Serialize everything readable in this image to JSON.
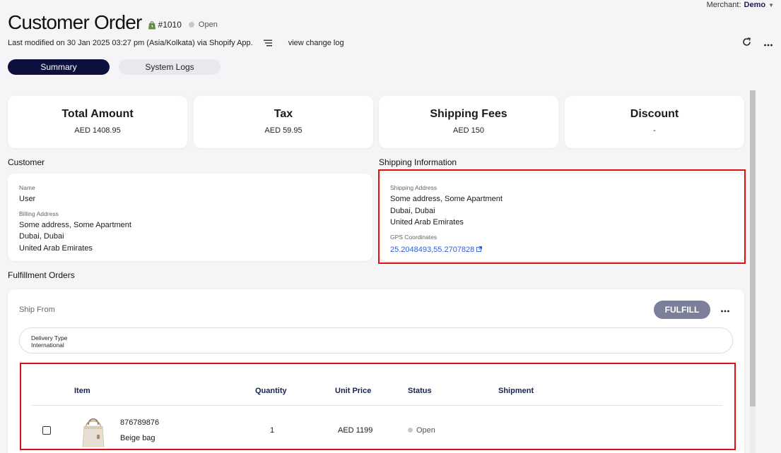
{
  "merchant": {
    "label": "Merchant:",
    "name": "Demo"
  },
  "header": {
    "title": "Customer Order",
    "order_number": "#1010",
    "status": "Open",
    "last_modified": "Last modified on 30 Jan 2025 03:27 pm (Asia/Kolkata) via Shopify App.",
    "change_log_link": "view change log"
  },
  "tabs": [
    {
      "label": "Summary",
      "active": true
    },
    {
      "label": "System Logs",
      "active": false
    }
  ],
  "stats": [
    {
      "label": "Total Amount",
      "value": "AED 1408.95"
    },
    {
      "label": "Tax",
      "value": "AED 59.95"
    },
    {
      "label": "Shipping Fees",
      "value": "AED 150"
    },
    {
      "label": "Discount",
      "value": "-"
    }
  ],
  "customer": {
    "heading": "Customer",
    "name_label": "Name",
    "name": "User",
    "billing_label": "Billing Address",
    "billing_lines": [
      "Some address, Some Apartment",
      "Dubai, Dubai",
      "United Arab Emirates"
    ]
  },
  "shipping": {
    "heading": "Shipping Information",
    "address_label": "Shipping Address",
    "address_lines": [
      "Some address, Some Apartment",
      "Dubai, Dubai",
      "United Arab Emirates"
    ],
    "gps_label": "GPS Coordinates",
    "gps_value": "25.2048493,55.2707828"
  },
  "fulfillment": {
    "heading": "Fulfillment Orders",
    "ship_from_label": "Ship From",
    "fulfill_button": "FULFILL",
    "delivery_type_label": "Delivery Type",
    "delivery_type_value": "International",
    "columns": [
      "Item",
      "Quantity",
      "Unit Price",
      "Status",
      "Shipment"
    ],
    "rows": [
      {
        "sku": "876789876",
        "name": "Beige bag",
        "quantity": "1",
        "unit_price": "AED 1199",
        "status": "Open",
        "shipment": ""
      }
    ]
  },
  "icons": {
    "shopify": "shopify-bag-icon",
    "list": "list-icon",
    "refresh": "refresh-icon",
    "more": "more-dots-icon",
    "external": "external-link-icon"
  },
  "colors": {
    "accent_navy": "#0d0f3d",
    "link_blue": "#2b5fd9",
    "highlight_red": "#e01010",
    "fulfill_button": "#7c7f99",
    "shopify_green": "#5e8e3e"
  }
}
